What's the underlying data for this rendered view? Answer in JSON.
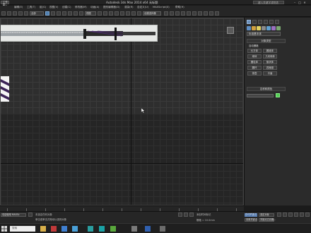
{
  "window": {
    "title": "Autodesk 3ds Max  2014 x64     无标题",
    "app_menu_label": "工作区: 默认",
    "search_placeholder": "键入关键字或短语",
    "min_label": "–",
    "max_label": "□",
    "close_label": "✕"
  },
  "menu": {
    "items": [
      "编辑(E)",
      "工具(T)",
      "组(G)",
      "视图(V)",
      "创建(C)",
      "修改器(M)",
      "动画(A)",
      "图形编辑器(D)",
      "渲染(R)",
      "自定义(U)",
      "MAXScript(X)",
      "帮助(H)"
    ]
  },
  "toolbar": {
    "selection_filter": "全部",
    "ref_coord": "视图",
    "named_selection": "创建选择集"
  },
  "command_panel": {
    "category_dropdown": "标准基本体",
    "rollout_object_type": "对象类型",
    "autogrid_label": "自动栅格",
    "primitives": [
      "长方体",
      "圆锥体",
      "球体",
      "几何球体",
      "圆柱体",
      "管状体",
      "圆环",
      "四棱锥",
      "茶壶",
      "平面"
    ],
    "rollout_name_color": "名称和颜色"
  },
  "statusbar": {
    "selection_text": "未选定任何对象",
    "prompt_text": "单击或单击并拖动以选择对象",
    "welcome_text": "欢迎使用 MAXSc",
    "grid_label": "栅格 = 10.0mm",
    "add_time_tag": "添加时间标记",
    "auto_key": "自动关键点",
    "set_key": "设置关键点",
    "selected_option": "选定对象",
    "key_filters": "关键点过滤器..."
  },
  "taskbar": {
    "search_placeholder": "搜索",
    "clock": "",
    "apps": [
      "file-explorer",
      "browser",
      "store",
      "mail",
      "media",
      "3dsmax",
      "chat",
      "photo",
      "word",
      "settings"
    ]
  },
  "colors": {
    "accent": "#5e8ec4",
    "swatch": "#55d055",
    "highlight_purple": "#4b2a6e"
  }
}
